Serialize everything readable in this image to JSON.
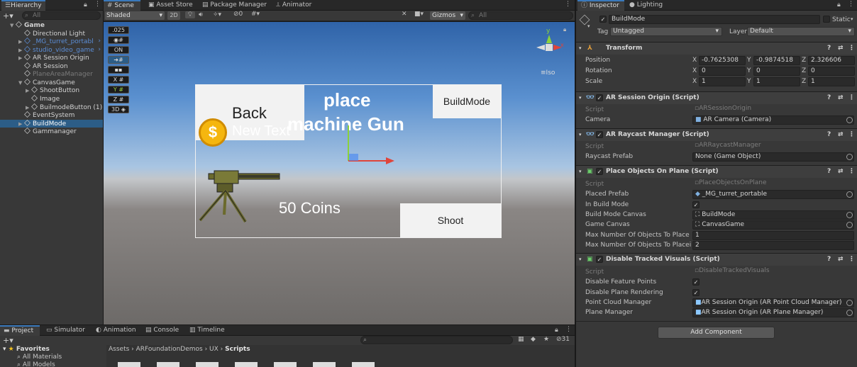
{
  "hierarchy": {
    "tab": "Hierarchy",
    "search_placeholder": "All",
    "items": [
      {
        "label": "Game",
        "indent": 0,
        "state": "expanded-bold"
      },
      {
        "label": "Directional Light",
        "indent": 1
      },
      {
        "label": "_MG_turret_portabl",
        "indent": 1,
        "state": "blue"
      },
      {
        "label": "studio_video_game",
        "indent": 1,
        "state": "blue"
      },
      {
        "label": "AR Session Origin",
        "indent": 1
      },
      {
        "label": "AR Session",
        "indent": 1
      },
      {
        "label": "PlaneAreaManager",
        "indent": 1,
        "state": "dim"
      },
      {
        "label": "CanvasGame",
        "indent": 1
      },
      {
        "label": "ShootButton",
        "indent": 2
      },
      {
        "label": "Image",
        "indent": 2
      },
      {
        "label": "BuilmodeButton (1)",
        "indent": 2
      },
      {
        "label": "EventSystem",
        "indent": 1
      },
      {
        "label": "BuildMode",
        "indent": 1,
        "state": "selected"
      },
      {
        "label": "Gammanager",
        "indent": 1
      }
    ]
  },
  "center_tabs": [
    "Scene",
    "Asset Store",
    "Package Manager",
    "Animator"
  ],
  "scene_toolbar": {
    "shading": "Shaded",
    "mode_2d": "2D",
    "gizmos": "Gizmos",
    "search_placeholder": "All",
    "hidden_count": "0"
  },
  "scene_side_tools": [
    ".025",
    "ON",
    "X",
    "Y",
    "Z",
    "3D"
  ],
  "gizmo": {
    "label": "Iso",
    "y": "y",
    "x": "x"
  },
  "game_view": {
    "back": "Back",
    "new_text": "New Text",
    "title_line1": "place",
    "title_line2": "machine Gun",
    "buildmode": "BuildMode",
    "coins": "50 Coins",
    "shoot": "Shoot",
    "coin_symbol": "$"
  },
  "bottom": {
    "tabs": [
      "Project",
      "Simulator",
      "Animation",
      "Console",
      "Timeline"
    ],
    "favorites": "Favorites",
    "fav_items": [
      "All Materials",
      "All Models"
    ],
    "breadcrumb": [
      "Assets",
      "ARFoundationDemos",
      "UX",
      "Scripts"
    ],
    "hidden_count": "31"
  },
  "inspector": {
    "tabs": [
      "Inspector",
      "Lighting"
    ],
    "object_name": "BuildMode",
    "static_label": "Static",
    "tag_label": "Tag",
    "tag_value": "Untagged",
    "layer_label": "Layer",
    "layer_value": "Default",
    "transform": {
      "title": "Transform",
      "position": {
        "label": "Position",
        "x": "-0.7625308",
        "y": "-0.9874518",
        "z": "2.326606"
      },
      "rotation": {
        "label": "Rotation",
        "x": "0",
        "y": "0",
        "z": "0"
      },
      "scale": {
        "label": "Scale",
        "x": "1",
        "y": "1",
        "z": "1"
      }
    },
    "ar_session_origin": {
      "title": "AR Session Origin (Script)",
      "script_label": "Script",
      "script": "ARSessionOrigin",
      "camera_label": "Camera",
      "camera": "AR Camera (Camera)"
    },
    "ar_raycast": {
      "title": "AR Raycast Manager (Script)",
      "script_label": "Script",
      "script": "ARRaycastManager",
      "prefab_label": "Raycast Prefab",
      "prefab": "None (Game Object)"
    },
    "place_objects": {
      "title": "Place Objects On Plane (Script)",
      "script_label": "Script",
      "script": "PlaceObjectsOnPlane",
      "placed_prefab_label": "Placed Prefab",
      "placed_prefab": "_MG_turret_portable",
      "in_build_label": "In Build Mode",
      "build_canvas_label": "Build Mode Canvas",
      "build_canvas": "BuildMode",
      "game_canvas_label": "Game Canvas",
      "game_canvas": "CanvasGame",
      "max_place_label": "Max Number Of Objects To Place",
      "max_place": "1",
      "max_placein_label": "Max Number Of Objects To Placein B",
      "max_placein": "2"
    },
    "disable_tracked": {
      "title": "Disable Tracked Visuals (Script)",
      "script_label": "Script",
      "script": "DisableTrackedVisuals",
      "feature_label": "Disable Feature Points",
      "plane_render_label": "Disable Plane Rendering",
      "pcm_label": "Point Cloud Manager",
      "pcm": "AR Session Origin (AR Point Cloud Manager)",
      "pm_label": "Plane Manager",
      "pm": "AR Session Origin (AR Plane Manager)"
    },
    "add_component": "Add Component"
  },
  "colors": {
    "accent": "#3a79bb",
    "selection": "#2c5d87",
    "coin": "#f5b60f"
  }
}
